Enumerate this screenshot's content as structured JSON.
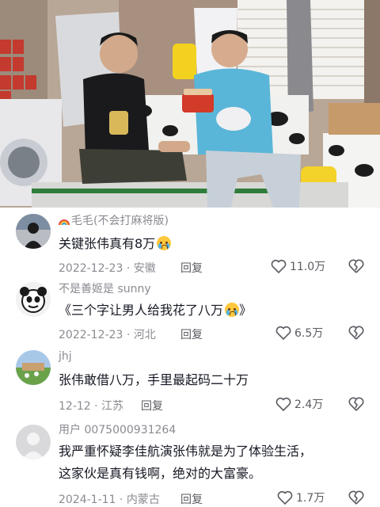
{
  "comments": [
    {
      "username": "毛毛",
      "username_tag": "(不会打麻将版)",
      "text": "关键张伟真有8万",
      "has_emoji": true,
      "date": "2022-12-23",
      "location": "安徽",
      "reply_label": "回复",
      "likes": "11.0万",
      "avatar_icon": "silhouette-avatar-icon"
    },
    {
      "username": "不是善姬是 sunny",
      "text": "《三个字让男人给我花了八万",
      "text_tail": "》",
      "has_emoji": true,
      "date": "2022-12-23",
      "location": "河北",
      "reply_label": "回复",
      "likes": "6.5万",
      "avatar_icon": "cartoon-panda-avatar-icon"
    },
    {
      "username": "jhj",
      "text": "张伟敢借八万，手里最起码二十万",
      "date": "12-12",
      "location": "江苏",
      "reply_label": "回复",
      "likes": "2.4万",
      "avatar_icon": "landscape-avatar-icon"
    },
    {
      "username": "用户 0075000931264",
      "text_line1": "我严重怀疑李佳航演张伟就是为了体验生活，",
      "text_line2": "这家伙是真有钱啊，绝对的大富豪。",
      "date": "2024-1-11",
      "location": "内蒙古",
      "reply_label": "回复",
      "likes": "1.7万",
      "avatar_icon": "default-user-avatar-icon"
    }
  ],
  "colors": {
    "text_primary": "#161823",
    "text_secondary": "#8a8b91",
    "avatar_default": "#d9d9dc"
  }
}
